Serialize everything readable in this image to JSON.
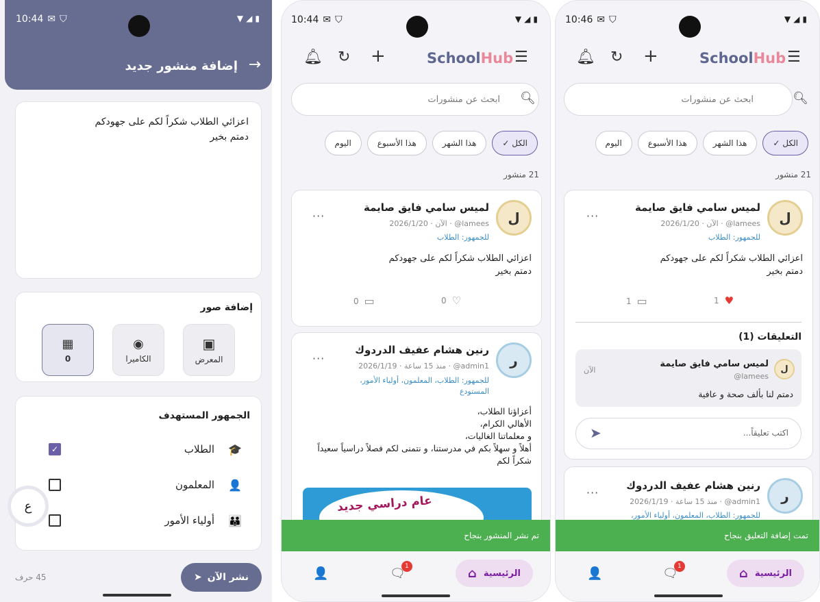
{
  "colors": {
    "header": "#676c91",
    "accent": "#6b5fa8",
    "brand_dark": "#5f6690",
    "brand_light": "#e8899b",
    "toast": "#4caf50",
    "link": "#3c8ec7",
    "like": "#e53935",
    "home_pill": "#eedcf0"
  },
  "screen1": {
    "time": "10:44",
    "title": "إضافة منشور جديد",
    "back_icon": "arrow-right-icon",
    "post_text": "اعزائي الطلاب شكراً لكم على جهودكم\nدمتم بخير",
    "images": {
      "title": "إضافة صور",
      "gallery": "المعرض",
      "camera": "الكاميرا",
      "count": "0"
    },
    "audience": {
      "title": "الجمهور المستهدف",
      "items": [
        {
          "label": "الطلاب",
          "checked": true
        },
        {
          "label": "المعلمون",
          "checked": false
        },
        {
          "label": "أولياء الأمور",
          "checked": false
        }
      ]
    },
    "fab_letter": "ع",
    "char_count": "45 حرف",
    "publish": "نشر الآن"
  },
  "screen2": {
    "time": "10:44",
    "brand": {
      "a": "School",
      "b": "Hub"
    },
    "search_placeholder": "ابحث عن منشورات",
    "filters": [
      "الكل",
      "هذا الشهر",
      "هذا الأسبوع",
      "اليوم"
    ],
    "count": "21 منشور",
    "post1": {
      "avatar": "ل",
      "name": "لميس سامي فايق صايمة",
      "meta": "lamees@ · الآن · 2026/1/20",
      "audience": "للجمهور: الطلاب",
      "body": "اعزائي الطلاب شكراً لكم على جهودكم\nدمتم بخير",
      "likes": "0",
      "comments": "0"
    },
    "post2": {
      "avatar": "ر",
      "name": "رنين هشام عفيف الدردوك",
      "meta": "admin1@ · منذ 15 ساعة · 2026/1/19",
      "audience": "للجمهور: الطلاب، المعلمون، أولياء الأمور، المستودع",
      "body": "أعزاؤنا الطلاب،\nالأهالي الكرام،\nو معلماتنا الغاليات،\nأهلاً و سهلاً بكم في مدرستنا، و نتمنى لكم فصلاً دراسياً سعيداً\nشكراً لكم",
      "image_text": "عام دراسي جديد"
    },
    "toast": "تم نشر المنشور بنجاح",
    "nav": {
      "home": "الرئيسية",
      "badge": "1"
    }
  },
  "screen3": {
    "time": "10:46",
    "brand": {
      "a": "School",
      "b": "Hub"
    },
    "search_placeholder": "ابحث عن منشورات",
    "filters": [
      "الكل",
      "هذا الشهر",
      "هذا الأسبوع",
      "اليوم"
    ],
    "count": "21 منشور",
    "post1": {
      "avatar": "ل",
      "name": "لميس سامي فايق صايمة",
      "meta": "lamees@ · الآن · 2026/1/20",
      "audience": "للجمهور: الطلاب",
      "body": "اعزائي الطلاب شكراً لكم على جهودكم\nدمتم بخير",
      "likes": "1",
      "comments": "1"
    },
    "comments_title": "التعليقات (1)",
    "comment": {
      "avatar": "ل",
      "name": "لميس سامي فايق صايمة",
      "handle": "lamees@",
      "time": "الآن",
      "text": "دمتم لنا بألف صحة و عافية"
    },
    "comment_placeholder": "اكتب تعليقاً...",
    "post2": {
      "avatar": "ر",
      "name": "رنين هشام عفيف الدردوك",
      "meta": "admin1@ · منذ 15 ساعة · 2026/1/19",
      "audience": "للجمهور: الطلاب، المعلمون، أولياء الأمور،"
    },
    "toast": "تمت إضافة التعليق بنجاح",
    "nav": {
      "home": "الرئيسية",
      "badge": "1"
    }
  }
}
